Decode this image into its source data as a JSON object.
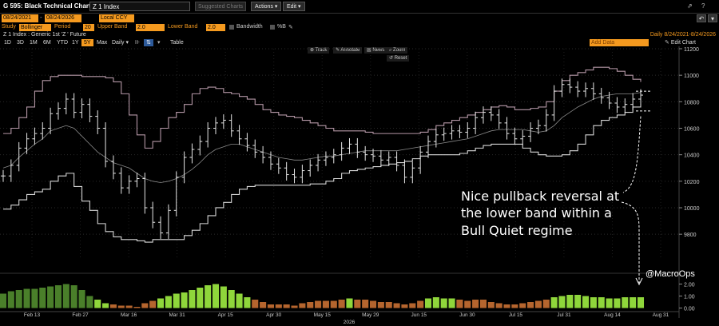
{
  "header": {
    "title": "G 595: Black Technical Chart",
    "ticker": "Z 1 Index",
    "suggested_charts": "Suggested Charts",
    "actions_label": "Actions",
    "edit_label": "Edit"
  },
  "dates": {
    "start": "08/24/2021",
    "end": "08/24/2026",
    "currency": "Local CCY"
  },
  "study": {
    "label": "Study",
    "name": "Bollinger",
    "period_label": "Period",
    "period": "20",
    "upper_label": "Upper Band",
    "upper": "2.0",
    "lower_label": "Lower Band",
    "lower": "2.0",
    "bandwidth_label": "Bandwidth",
    "percentb_label": "%B"
  },
  "info": {
    "security": "Z 1 Index : Generic 1st 'Z ' Future",
    "range": "Daily  8/24/2021-8/24/2026"
  },
  "periods": [
    "1D",
    "3D",
    "1M",
    "6M",
    "YTD",
    "1Y",
    "5Y",
    "Max"
  ],
  "active_period": "5Y",
  "frequency": "Daily",
  "table_label": "Table",
  "add_data": "Add Data",
  "edit_chart": "Edit Chart",
  "tools": {
    "track": "Track",
    "annotate": "Annotate",
    "news": "News",
    "zoom": "Zoom",
    "reset": "Reset"
  },
  "annotation": {
    "lines": [
      "Nice pullback reversal at",
      "the lower band within a",
      "Bull Quiet regime"
    ],
    "handle": "@MacroOps"
  },
  "colors": {
    "background": "#000000",
    "price": "#e6e6e6",
    "upper_band": "#b497a6",
    "lower_band": "#d6d6d6",
    "middle_band": "#8a8a8a",
    "accent": "#f59a1f",
    "histogram_up": "#8fd63b",
    "histogram_up_dark": "#4a7f2a",
    "histogram_down": "#b5652e"
  },
  "chart_data": {
    "type": "line",
    "title": "",
    "xlabel": "2026",
    "ylabel": "",
    "ylim": [
      9620,
      11200
    ],
    "y_ticks": [
      11200,
      11000,
      10800,
      10600,
      10400,
      10200,
      10000,
      9800
    ],
    "x_tick_labels": [
      "Feb 13",
      "Feb 27",
      "Mar 16",
      "Mar 31",
      "Apr 15",
      "Apr 30",
      "May 15",
      "May 29",
      "Jun 15",
      "Jun 30",
      "Jul 15",
      "Jul 31",
      "Aug 14",
      "Aug 31"
    ],
    "series": [
      {
        "name": "",
        "values": [
          10240,
          10320,
          10450,
          10520,
          10560,
          10600,
          10710,
          10750,
          10820,
          10720,
          10780,
          10690,
          10600,
          10350,
          10260,
          10150,
          10200,
          10220,
          10000,
          9890,
          9810,
          9980,
          10230,
          10380,
          10440,
          10500,
          10600,
          10640,
          10660,
          10580,
          10520,
          10470,
          10420,
          10380,
          10330,
          10300,
          10250,
          10230,
          10280,
          10320,
          10360,
          10380,
          10400,
          10450,
          10480,
          10420,
          10400,
          10390,
          10360,
          10380,
          10320,
          10230,
          10300,
          10420,
          10500,
          10550,
          10560,
          10580,
          10570,
          10600,
          10680,
          10720,
          10700,
          10640,
          10560,
          10520,
          10540,
          10600,
          10620,
          10700,
          10880,
          10930,
          10910,
          10880,
          10900,
          10860,
          10830,
          10790,
          10760,
          10780,
          10820,
          10850
        ]
      },
      {
        "name": "",
        "values": [
          10560,
          10600,
          10680,
          10760,
          10880,
          10960,
          10990,
          11000,
          11000,
          11000,
          10990,
          10990,
          10990,
          10980,
          10950,
          10860,
          10700,
          10550,
          10450,
          10500,
          10600,
          10680,
          10720,
          10780,
          10860,
          10900,
          10910,
          10900,
          10870,
          10860,
          10840,
          10820,
          10780,
          10740,
          10720,
          10700,
          10690,
          10680,
          10660,
          10640,
          10620,
          10600,
          10580,
          10580,
          10580,
          10580,
          10570,
          10560,
          10560,
          10560,
          10560,
          10560,
          10560,
          10570,
          10590,
          10620,
          10640,
          10660,
          10680,
          10700,
          10720,
          10740,
          10760,
          10770,
          10760,
          10740,
          10740,
          10750,
          10760,
          10800,
          10880,
          10960,
          11000,
          11020,
          11040,
          11060,
          11060,
          11050,
          11030,
          11000,
          10970,
          10950
        ]
      },
      {
        "name": "",
        "values": [
          9990,
          10020,
          10060,
          10100,
          10120,
          10140,
          10200,
          10240,
          10260,
          10160,
          10050,
          9980,
          9880,
          9820,
          9780,
          9760,
          9760,
          9750,
          9740,
          9760,
          9760,
          9760,
          9760,
          9790,
          9830,
          9880,
          9940,
          10000,
          10040,
          10100,
          10140,
          10160,
          10170,
          10170,
          10170,
          10170,
          10170,
          10170,
          10170,
          10180,
          10180,
          10200,
          10220,
          10260,
          10280,
          10290,
          10300,
          10310,
          10320,
          10330,
          10340,
          10350,
          10370,
          10390,
          10400,
          10400,
          10400,
          10400,
          10410,
          10430,
          10450,
          10470,
          10480,
          10480,
          10480,
          10480,
          10450,
          10420,
          10400,
          10390,
          10390,
          10400,
          10430,
          10480,
          10550,
          10620,
          10660,
          10680,
          10700,
          10720,
          10760,
          10780
        ]
      },
      {
        "name": "",
        "values": [
          10300,
          10320,
          10380,
          10430,
          10480,
          10520,
          10580,
          10600,
          10620,
          10600,
          10540,
          10480,
          10420,
          10380,
          10340,
          10320,
          10300,
          10260,
          10220,
          10200,
          10190,
          10200,
          10220,
          10250,
          10290,
          10340,
          10400,
          10440,
          10460,
          10480,
          10480,
          10460,
          10440,
          10420,
          10400,
          10380,
          10370,
          10360,
          10360,
          10370,
          10380,
          10390,
          10390,
          10400,
          10410,
          10420,
          10430,
          10430,
          10430,
          10430,
          10430,
          10440,
          10450,
          10460,
          10470,
          10480,
          10490,
          10500,
          10510,
          10520,
          10540,
          10560,
          10580,
          10590,
          10590,
          10590,
          10590,
          10580,
          10570,
          10580,
          10620,
          10680,
          10720,
          10760,
          10790,
          10820,
          10840,
          10850,
          10860,
          10860,
          10860,
          10870
        ]
      }
    ],
    "histogram": [
      1.2,
      1.4,
      1.5,
      1.6,
      1.6,
      1.7,
      1.8,
      1.9,
      2.0,
      1.9,
      1.5,
      1.0,
      0.7,
      0.4,
      0.3,
      0.2,
      0.2,
      0.1,
      0.4,
      0.6,
      0.8,
      1.0,
      1.2,
      1.3,
      1.5,
      1.7,
      1.9,
      2.0,
      1.8,
      1.5,
      1.2,
      0.9,
      0.7,
      0.5,
      0.3,
      0.3,
      0.3,
      0.2,
      0.4,
      0.5,
      0.6,
      0.6,
      0.6,
      0.7,
      0.8,
      0.7,
      0.7,
      0.6,
      0.5,
      0.5,
      0.4,
      0.3,
      0.4,
      0.6,
      0.8,
      0.9,
      0.8,
      0.8,
      0.7,
      0.6,
      0.7,
      0.7,
      0.5,
      0.4,
      0.3,
      0.3,
      0.4,
      0.5,
      0.6,
      0.7,
      0.9,
      1.0,
      1.1,
      1.1,
      1.0,
      0.9,
      0.9,
      0.8,
      0.8,
      0.9,
      0.9,
      0.9
    ],
    "histogram_ticks": [
      "2.00",
      "1.00",
      "0.00"
    ],
    "histogram_ylim": [
      -0.3,
      2.5
    ]
  }
}
